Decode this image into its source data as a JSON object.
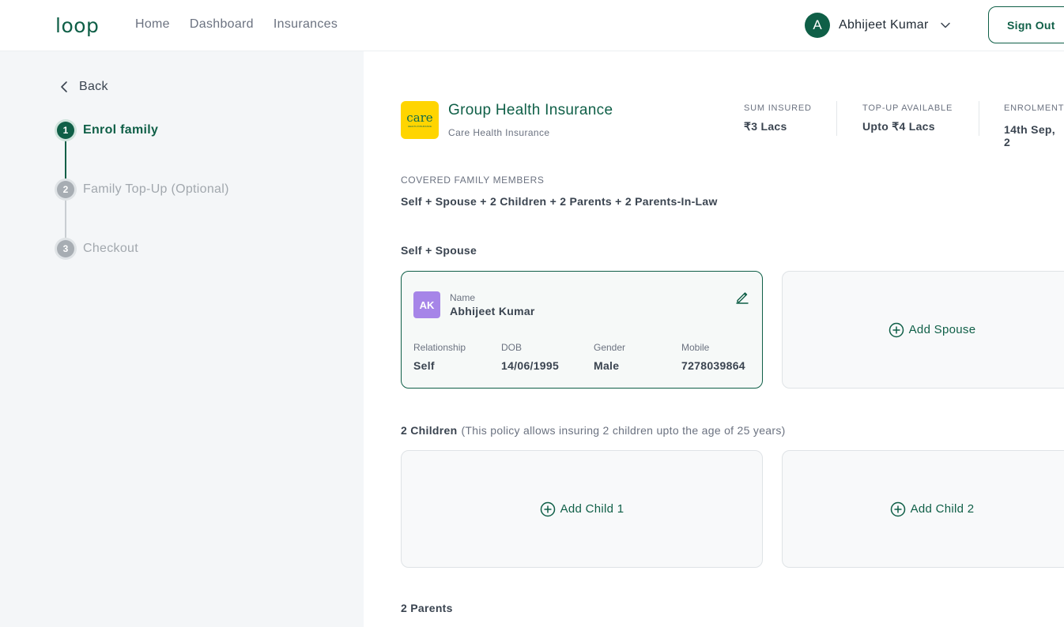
{
  "header": {
    "logo": "loop",
    "nav": [
      "Home",
      "Dashboard",
      "Insurances"
    ],
    "user": {
      "initial": "A",
      "name": "Abhijeet Kumar"
    },
    "sign_out": "Sign Out"
  },
  "sidebar": {
    "back": "Back",
    "steps": [
      {
        "num": "1",
        "label": "Enrol family",
        "state": "active"
      },
      {
        "num": "2",
        "label": "Family Top-Up (Optional)",
        "state": "inactive"
      },
      {
        "num": "3",
        "label": "Checkout",
        "state": "inactive"
      }
    ]
  },
  "policy": {
    "logo_text": "care",
    "logo_sub": "HEALTH INSURANCE",
    "title": "Group Health Insurance",
    "provider": "Care Health Insurance",
    "stats": [
      {
        "label": "SUM INSURED",
        "value": "₹3 Lacs"
      },
      {
        "label": "TOP-UP AVAILABLE",
        "value": "Upto ₹4 Lacs"
      },
      {
        "label": "ENROLMENT",
        "value": "14th Sep, 2"
      }
    ]
  },
  "covered": {
    "label": "COVERED FAMILY MEMBERS",
    "value": "Self + Spouse + 2 Children + 2 Parents + 2 Parents-In-Law"
  },
  "groups": {
    "self_spouse": {
      "title": "Self + Spouse",
      "member": {
        "initials": "AK",
        "name_label": "Name",
        "name": "Abhijeet Kumar",
        "fields": [
          {
            "label": "Relationship",
            "value": "Self"
          },
          {
            "label": "DOB",
            "value": "14/06/1995"
          },
          {
            "label": "Gender",
            "value": "Male"
          },
          {
            "label": "Mobile",
            "value": "7278039864"
          }
        ]
      },
      "add_label": "Add Spouse"
    },
    "children": {
      "title": "2 Children",
      "note": "(This policy allows insuring 2 children upto the age of 25 years)",
      "add_labels": [
        "Add Child 1",
        "Add Child 2"
      ]
    },
    "parents": {
      "title": "2 Parents"
    }
  },
  "colors": {
    "brand": "#0f5f47",
    "avatar_purple": "#a685e8",
    "care_yellow": "#ffd500"
  }
}
